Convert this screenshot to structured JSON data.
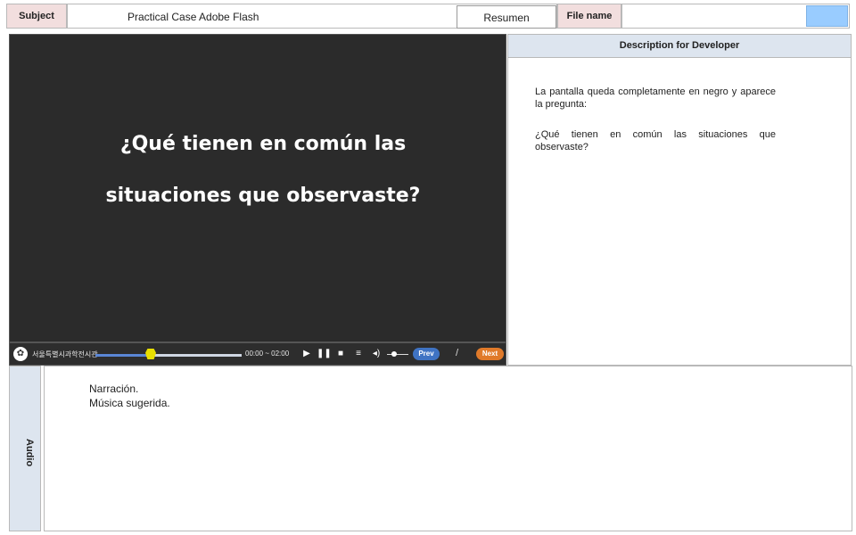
{
  "header": {
    "subject_label": "Subject",
    "subject_value": "Practical Case Adobe Flash",
    "resumen_label": "Resumen",
    "file_name_label": "File name",
    "file_name_value": "",
    "swatch_color": "#99ccff"
  },
  "video": {
    "question_line1": "¿Qué tienen en común las",
    "question_line2": "situaciones  que observaste?"
  },
  "player": {
    "logo_text": "서울특별시과학전시관",
    "time_text": "00:00 ~ 02:00",
    "prev_label": "Prev",
    "next_label": "Next",
    "separator": "/",
    "progress": 0.35,
    "icons": [
      "play-icon",
      "pause-icon",
      "stop-icon",
      "menu-icon",
      "volume-icon"
    ]
  },
  "description": {
    "title": "Description for Developer",
    "para1": "La pantalla queda completamente en negro y aparece la pregunta:",
    "para2": "¿Qué tienen en común las situaciones que observaste?"
  },
  "audio": {
    "label": "Audio",
    "line1": "Narración.",
    "line2": "Música sugerida."
  }
}
